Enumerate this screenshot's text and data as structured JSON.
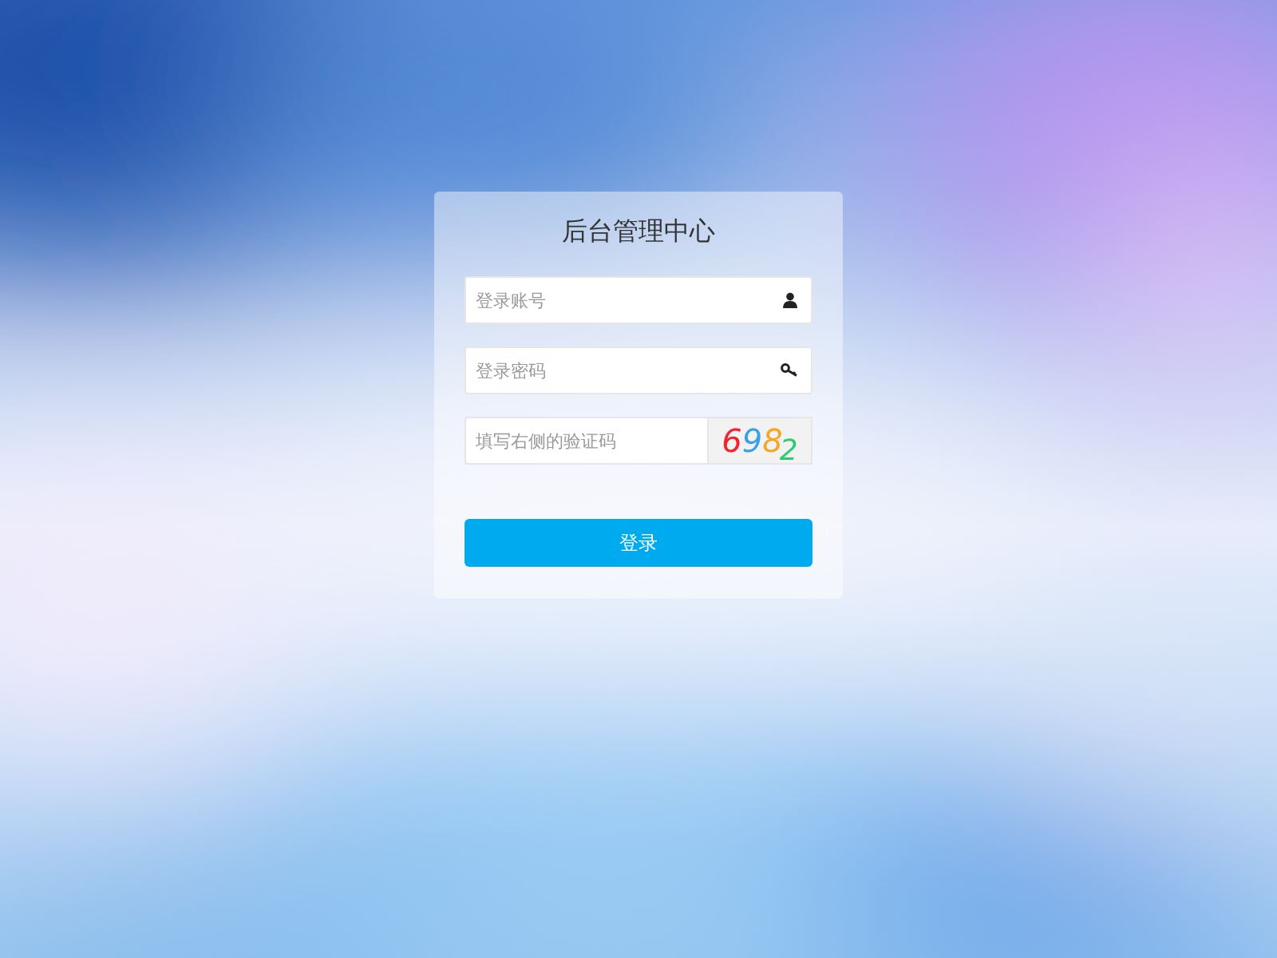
{
  "title": "后台管理中心",
  "fields": [
    {
      "kind": "account",
      "placeholder": "登录账号"
    },
    {
      "kind": "password",
      "placeholder": "登录密码"
    },
    {
      "kind": "captcha",
      "placeholder": "填写右侧的验证码"
    }
  ],
  "captcha": [
    {
      "text": "6",
      "color": "#f5222d",
      "lowered": false
    },
    {
      "text": "9",
      "color": "#3aa0e8",
      "lowered": false
    },
    {
      "text": "8",
      "color": "#f5a623",
      "lowered": false
    },
    {
      "text": "2",
      "color": "#2ecc71",
      "lowered": true
    }
  ],
  "button": "登录"
}
